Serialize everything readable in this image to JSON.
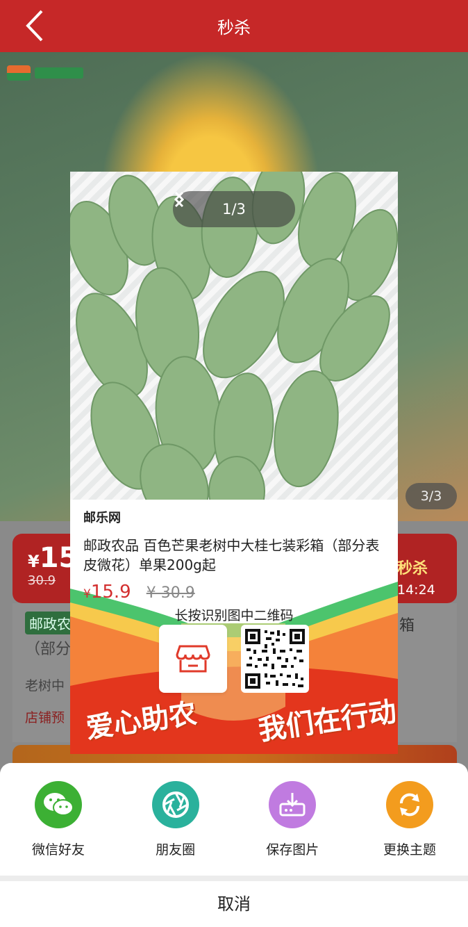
{
  "header": {
    "title": "秒杀"
  },
  "background_page": {
    "image_counter": "3/3",
    "price_symbol": "¥",
    "price": "15",
    "old_price": "30.9",
    "sale_label": "秒杀",
    "countdown": "14:24",
    "tag": "邮政农",
    "title_fragment": "（部分",
    "title_side": "箱",
    "subtitle_fragment": "老树中",
    "shop_preview": "店铺预"
  },
  "poster": {
    "pager": {
      "count": "1/3"
    },
    "site_name": "邮乐网",
    "product_title": "邮政农品 百色芒果老树中大桂七装彩箱（部分表皮微花）单果200g起",
    "price_symbol": "¥",
    "price": "15.9",
    "old_price": "¥ 30.9",
    "qr_hint": "长按识别图中二维码",
    "slogan_left": "爱心助农",
    "slogan_right": "我们在行动",
    "accent_green": "#2fb85a",
    "accent_red": "#e3361d"
  },
  "share_sheet": {
    "items": [
      {
        "label": "微信好友",
        "icon": "wechat-icon",
        "color": "#3cb034"
      },
      {
        "label": "朋友圈",
        "icon": "moments-icon",
        "color": "#2ab19c"
      },
      {
        "label": "保存图片",
        "icon": "save-image-icon",
        "color": "#c07be0"
      },
      {
        "label": "更换主题",
        "icon": "refresh-icon",
        "color": "#f39c1e"
      }
    ],
    "cancel_label": "取消"
  }
}
